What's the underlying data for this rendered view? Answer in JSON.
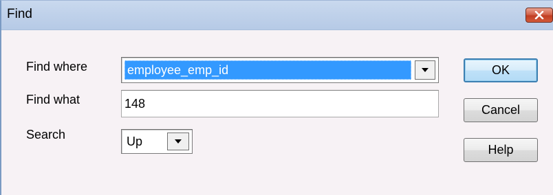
{
  "window": {
    "title": "Find"
  },
  "form": {
    "find_where_label": "Find where",
    "find_where_value": "employee_emp_id",
    "find_what_label": "Find what",
    "find_what_value": "148",
    "search_label": "Search",
    "search_value": "Up"
  },
  "buttons": {
    "ok": "OK",
    "cancel": "Cancel",
    "help": "Help"
  },
  "icons": {
    "close": "close-icon",
    "dropdown": "chevron-down-icon"
  },
  "colors": {
    "selection": "#3399ff",
    "title_bar": "#bfd1ea",
    "close_button": "#c94a2e",
    "dialog_background": "#f7f2f5",
    "default_button_border": "#3c7fb1"
  }
}
